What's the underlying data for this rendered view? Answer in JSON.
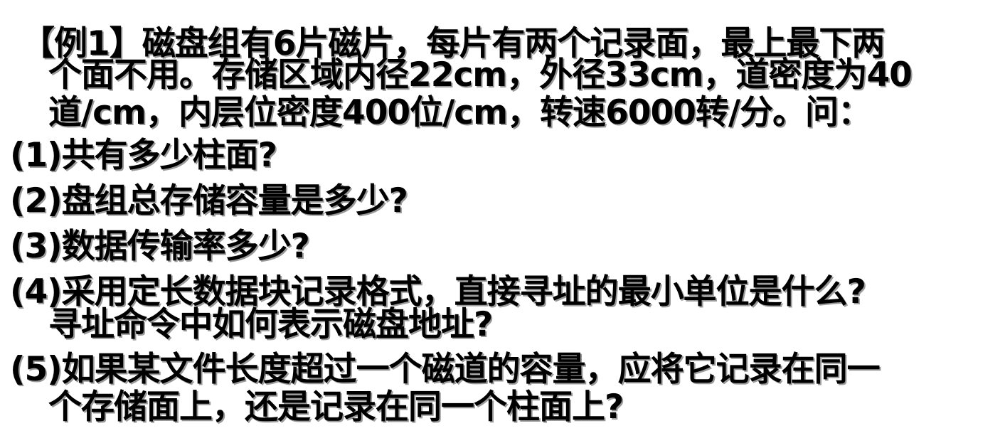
{
  "problem": {
    "intro": [
      "【例1】磁盘组有6片磁片，每片有两个记录面，最上最下两",
      "个面不用。存储区域内径22cm，外径33cm，道密度为40",
      "道/cm，内层位密度400位/cm，转速6000转/分。问："
    ],
    "questions": [
      {
        "number": "(1)",
        "lines": [
          "共有多少柱面?"
        ]
      },
      {
        "number": "(2)",
        "lines": [
          "盘组总存储容量是多少?"
        ]
      },
      {
        "number": "(3)",
        "lines": [
          "数据传输率多少?"
        ]
      },
      {
        "number": "(4)",
        "lines": [
          "采用定长数据块记录格式，直接寻址的最小单位是什么?",
          "寻址命令中如何表示磁盘地址?"
        ]
      },
      {
        "number": "(5)",
        "lines": [
          "如果某文件长度超过一个磁道的容量，应将它记录在同一",
          "个存储面上，还是记录在同一个柱面上?"
        ]
      }
    ]
  }
}
